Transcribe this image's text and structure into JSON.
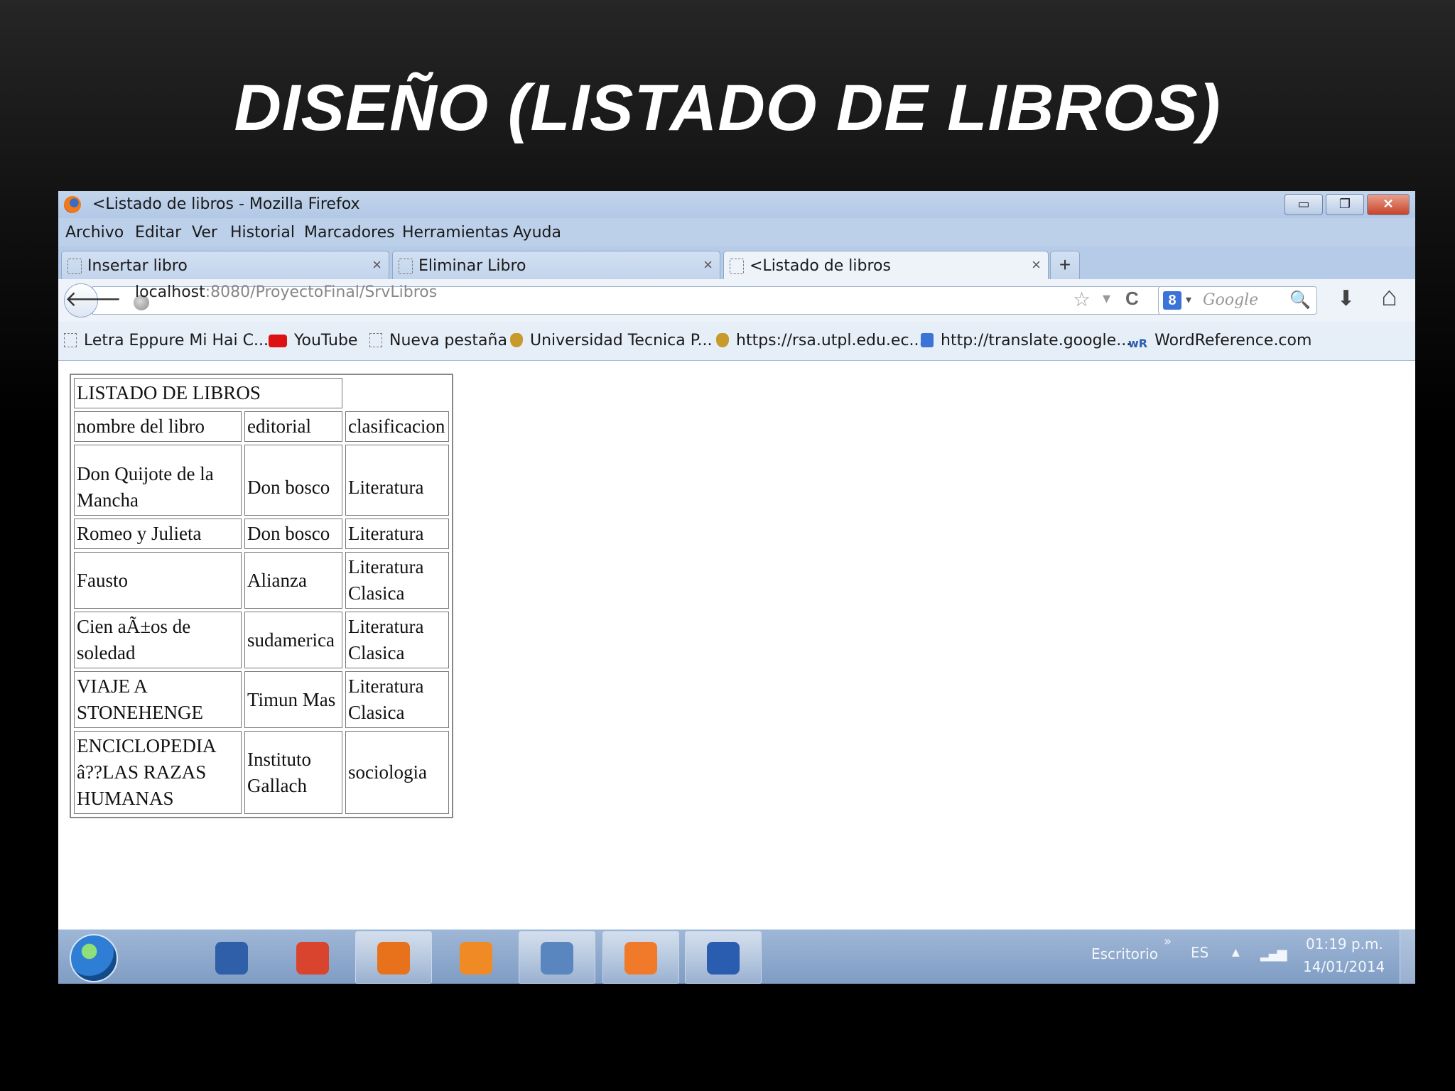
{
  "slide": {
    "title": "DISEÑO (LISTADO DE LIBROS)"
  },
  "window": {
    "title": "<Listado de libros - Mozilla Firefox",
    "controls": {
      "minimize": "▭",
      "restore": "❐",
      "close": "✕"
    }
  },
  "menu": [
    "Archivo",
    "Editar",
    "Ver",
    "Historial",
    "Marcadores",
    "Herramientas",
    "Ayuda"
  ],
  "tabs": [
    {
      "label": "Insertar libro",
      "close": "×"
    },
    {
      "label": "Eliminar Libro",
      "close": "×"
    },
    {
      "label": "<Listado de libros",
      "close": "×"
    }
  ],
  "new_tab_label": "+",
  "nav": {
    "back": "🡐",
    "url_host": "localhost",
    "url_rest": ":8080/ProyectoFinal/SrvLibros",
    "star": "☆",
    "dropdown": "▾",
    "reload": "C",
    "search_engine_badge": "8",
    "search_placeholder": "Google",
    "search_icon": "🔍",
    "download_icon": "⬇",
    "home_icon": "⌂"
  },
  "bookmarks": [
    {
      "label": "Letra Eppure Mi Hai C...",
      "icon": "page-icon"
    },
    {
      "label": "YouTube",
      "icon": "youtube-icon"
    },
    {
      "label": "Nueva pestaña",
      "icon": "page-icon"
    },
    {
      "label": "Universidad Tecnica P...",
      "icon": "crest-icon"
    },
    {
      "label": "https://rsa.utpl.edu.ec...",
      "icon": "crest-icon"
    },
    {
      "label": "http://translate.google...",
      "icon": "translate-icon"
    },
    {
      "label": "WordReference.com",
      "icon": "wordreference-icon",
      "badge": "wR"
    }
  ],
  "table": {
    "title": "LISTADO DE LIBROS",
    "headers": [
      "nombre del libro",
      "editorial",
      "clasificacion"
    ],
    "rows": [
      [
        "Don Quijote de la Mancha",
        "Don bosco",
        "Literatura"
      ],
      [
        "Romeo y Julieta",
        "Don bosco",
        "Literatura"
      ],
      [
        "Fausto",
        "Alianza",
        "Literatura Clasica"
      ],
      [
        "Cien aÃ±os de soledad",
        "sudamerica",
        "Literatura Clasica"
      ],
      [
        "VIAJE A STONEHENGE",
        "Timun Mas",
        "Literatura Clasica"
      ],
      [
        "ENCICLOPEDIA â??LAS RAZAS HUMANAS",
        "Instituto Gallach",
        "sociologia"
      ]
    ]
  },
  "taskbar": {
    "apps": [
      {
        "name": "messenger-icon",
        "color": "#2f5fa8"
      },
      {
        "name": "chrome-icon",
        "color": "#d9442e"
      },
      {
        "name": "firefox-icon",
        "color": "#e8721c"
      },
      {
        "name": "media-player-icon",
        "color": "#f08a24"
      },
      {
        "name": "cube-app-icon",
        "color": "#5a86c0"
      },
      {
        "name": "xampp-icon",
        "color": "#f07a2a"
      },
      {
        "name": "word-icon",
        "color": "#2a5db0"
      }
    ],
    "desktop_label": "Escritorio",
    "chevron": "»",
    "lang": "ES",
    "tray_arrow": "▲",
    "time": "01:19 p.m.",
    "date": "14/01/2014"
  }
}
